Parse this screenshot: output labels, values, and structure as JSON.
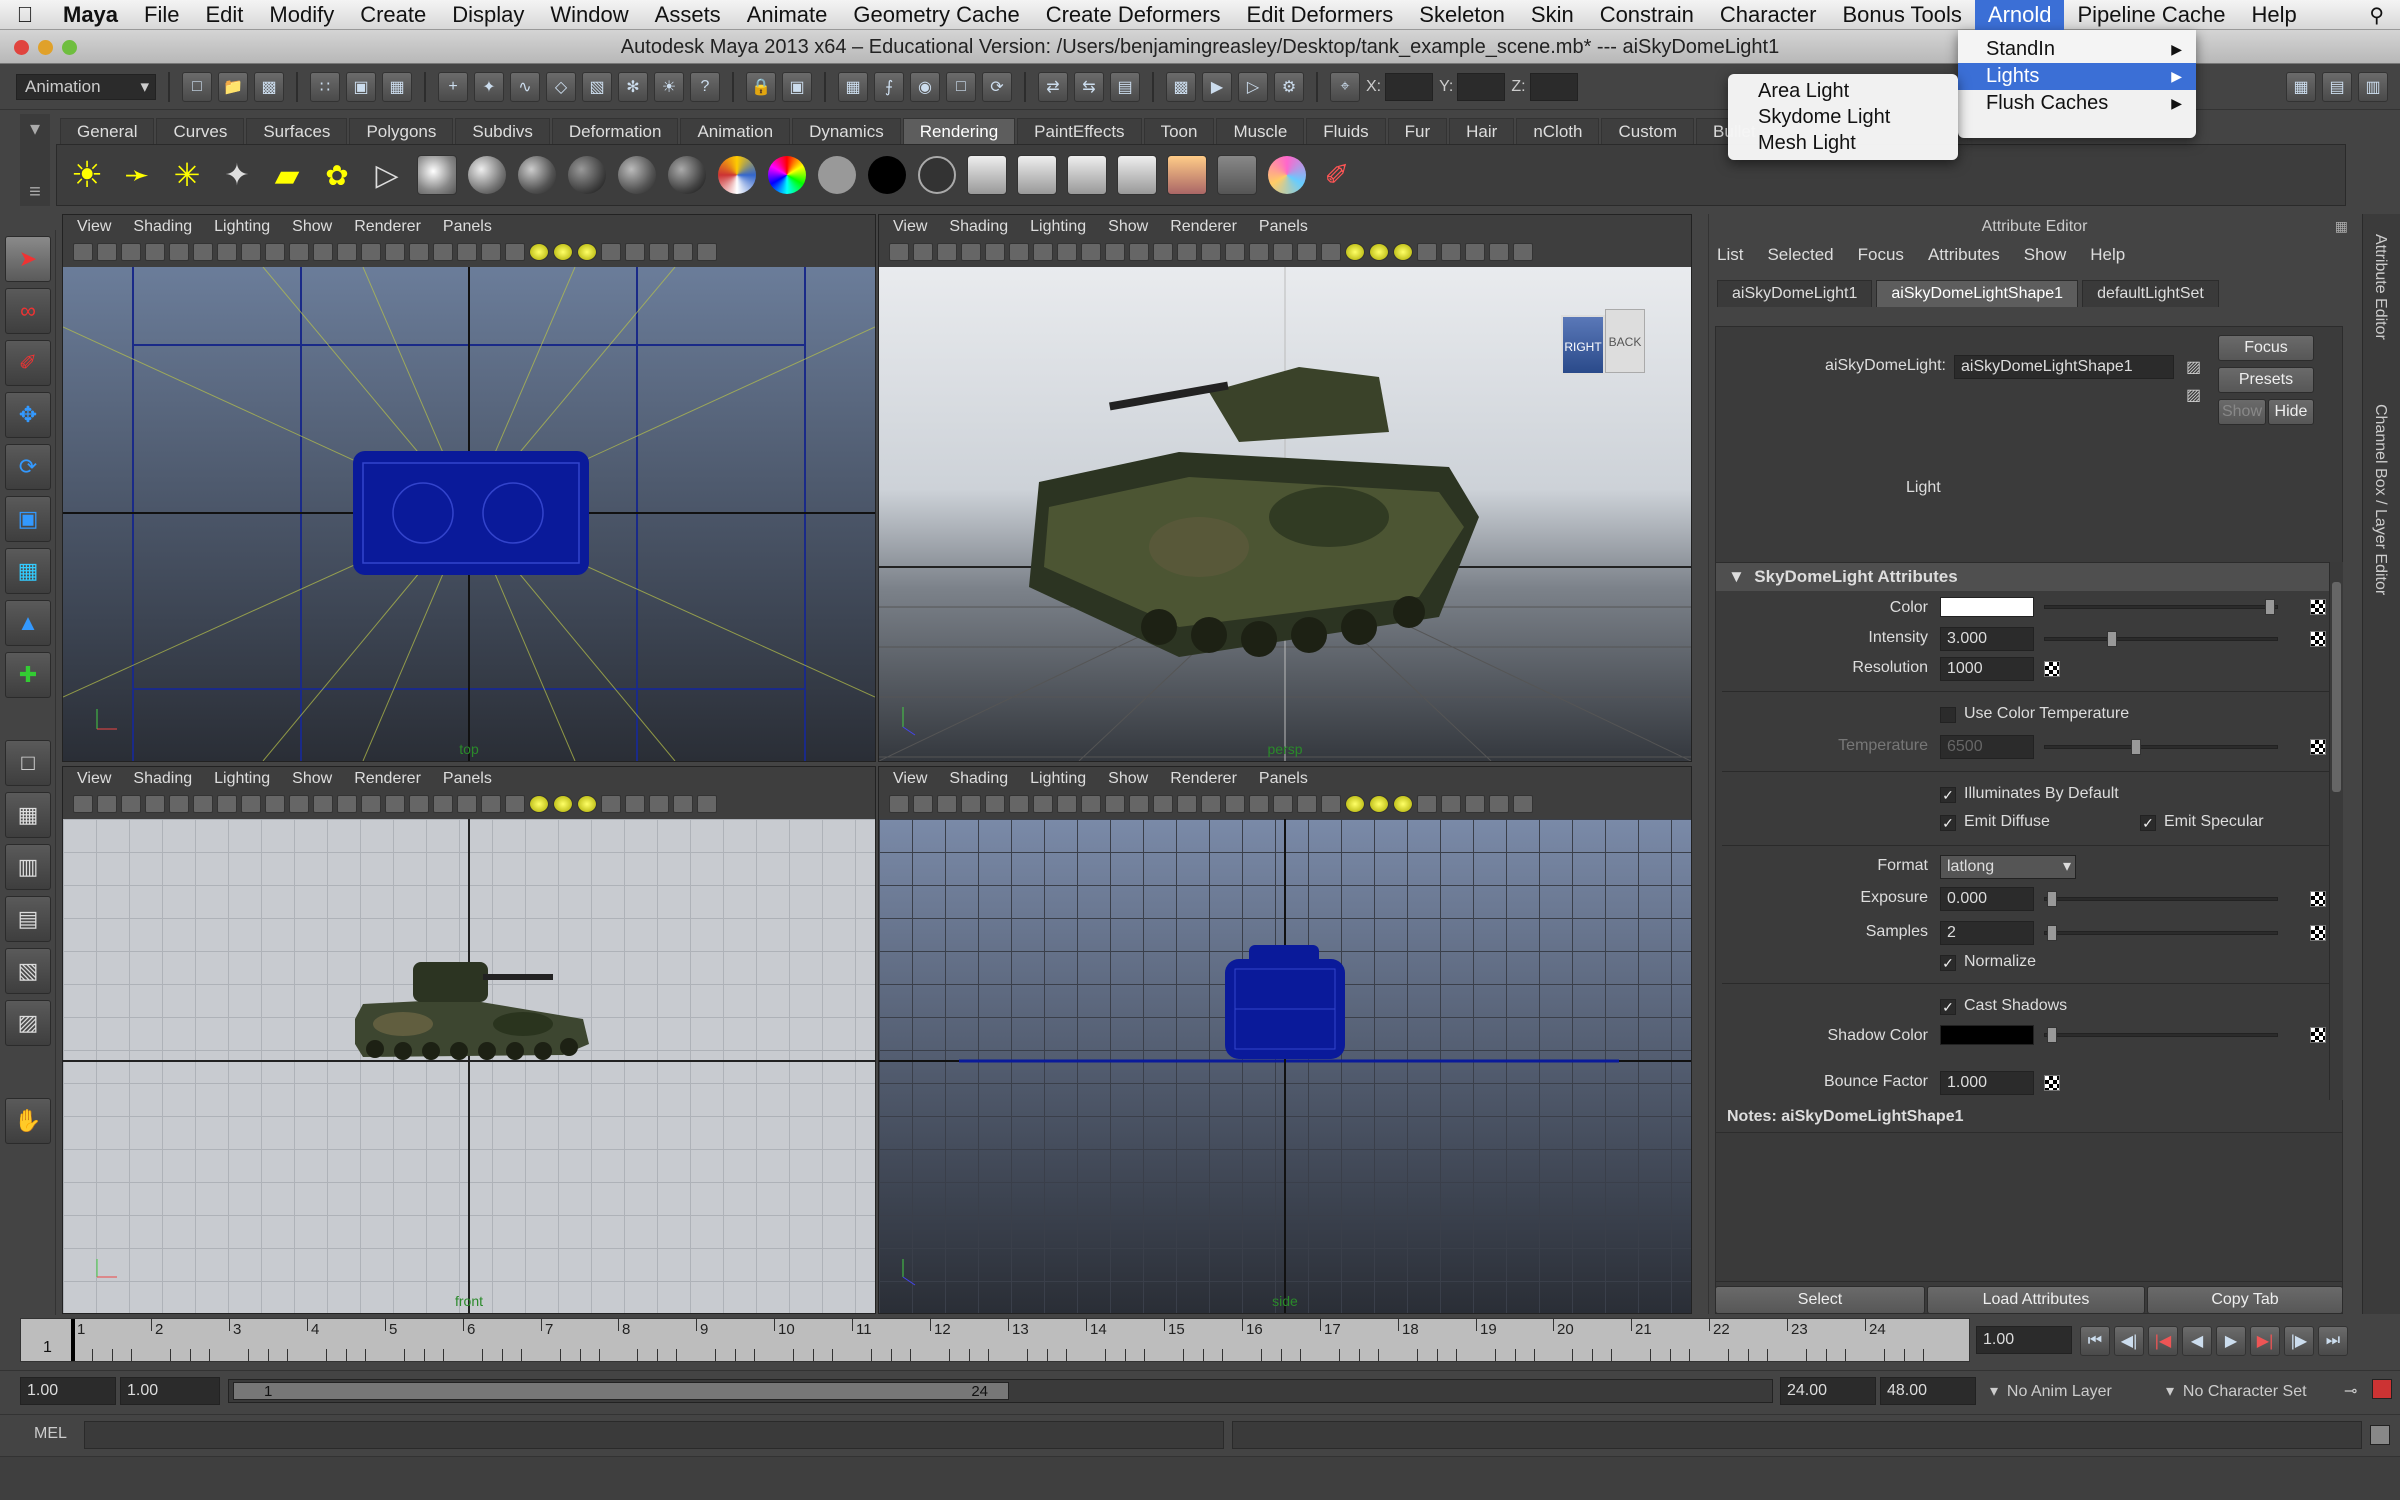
{
  "menubar": {
    "app": "Maya",
    "items": [
      "File",
      "Edit",
      "Modify",
      "Create",
      "Display",
      "Window",
      "Assets",
      "Animate",
      "Geometry Cache",
      "Create Deformers",
      "Edit Deformers",
      "Skeleton",
      "Skin",
      "Constrain",
      "Character",
      "Bonus Tools",
      "Arnold",
      "Pipeline Cache",
      "Help"
    ],
    "active": "Arnold"
  },
  "window": {
    "title": "Autodesk Maya 2013 x64 – Educational Version: /Users/benjamingreasley/Desktop/tank_example_scene.mb*   ---   aiSkyDomeLight1"
  },
  "statusline": {
    "mode": "Animation",
    "x_label": "X:",
    "y_label": "Y:",
    "z_label": "Z:"
  },
  "shelf": {
    "tabs": [
      "General",
      "Curves",
      "Surfaces",
      "Polygons",
      "Subdivs",
      "Deformation",
      "Animation",
      "Dynamics",
      "Rendering",
      "PaintEffects",
      "Toon",
      "Muscle",
      "Fluids",
      "Fur",
      "Hair",
      "nCloth",
      "Custom",
      "Bullet"
    ],
    "active": "Rendering"
  },
  "arnold_menu": {
    "items": [
      "StandIn",
      "Lights",
      "Flush Caches"
    ],
    "selected": "Lights"
  },
  "lights_submenu": {
    "items": [
      "Area Light",
      "Skydome Light",
      "Mesh Light"
    ]
  },
  "viewports": {
    "menu": [
      "View",
      "Shading",
      "Lighting",
      "Show",
      "Renderer",
      "Panels"
    ],
    "top_label": "top",
    "persp_label": "persp",
    "front_label": "front",
    "side_label": "side",
    "view_cube_right": "RIGHT",
    "view_cube_back": "BACK"
  },
  "attribute_editor": {
    "header": "Attribute Editor",
    "menu": [
      "List",
      "Selected",
      "Focus",
      "Attributes",
      "Show",
      "Help"
    ],
    "tabs": [
      "aiSkyDomeLight1",
      "aiSkyDomeLightShape1",
      "defaultLightSet"
    ],
    "active_tab": "aiSkyDomeLightShape1",
    "node_label": "aiSkyDomeLight:",
    "node_value": "aiSkyDomeLightShape1",
    "focus_btn": "Focus",
    "presets_btn": "Presets",
    "show_btn": "Show",
    "hide_btn": "Hide",
    "light_label": "Light",
    "section_title": "SkyDomeLight Attributes",
    "color_label": "Color",
    "intensity_label": "Intensity",
    "intensity_value": "3.000",
    "resolution_label": "Resolution",
    "resolution_value": "1000",
    "use_color_temp": "Use Color Temperature",
    "temperature_label": "Temperature",
    "temperature_value": "6500",
    "illuminates_default": "Illuminates By Default",
    "emit_diffuse": "Emit Diffuse",
    "emit_specular": "Emit Specular",
    "format_label": "Format",
    "format_value": "latlong",
    "exposure_label": "Exposure",
    "exposure_value": "0.000",
    "samples_label": "Samples",
    "samples_value": "2",
    "normalize": "Normalize",
    "cast_shadows": "Cast Shadows",
    "shadow_color_label": "Shadow Color",
    "bounce_label": "Bounce Factor",
    "bounce_value": "1.000",
    "notes_label": "Notes:  aiSkyDomeLightShape1",
    "select_btn": "Select",
    "load_btn": "Load Attributes",
    "copy_btn": "Copy Tab"
  },
  "right_strip": {
    "tab1": "Attribute Editor",
    "tab2": "Channel Box / Layer Editor"
  },
  "timeline": {
    "ticks": [
      "1",
      "2",
      "3",
      "4",
      "5",
      "6",
      "7",
      "8",
      "9",
      "10",
      "11",
      "12",
      "13",
      "14",
      "15",
      "16",
      "17",
      "18",
      "19",
      "20",
      "21",
      "22",
      "23",
      "24"
    ],
    "current_frame": "1.00",
    "current_marker": "1"
  },
  "range": {
    "start": "1.00",
    "inner_start": "1.00",
    "slider_start": "1",
    "slider_end": "24",
    "end": "24.00",
    "outer_end": "48.00",
    "anim_layer": "No Anim Layer",
    "char_set": "No Character Set"
  },
  "cmdline": {
    "label": "MEL"
  },
  "colors": {
    "mac_highlight": "#3b6fd6",
    "wire_blue": "#0a1a9a",
    "viewport_bg_top": "#6b7d9a",
    "viewport_bg_bottom": "#2a2e36",
    "front_bg": "#c8cbd0"
  }
}
